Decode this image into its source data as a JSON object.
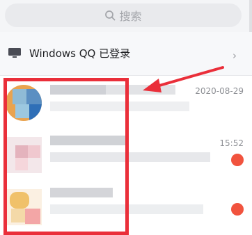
{
  "search": {
    "placeholder": "搜索"
  },
  "device": {
    "label": "Windows QQ 已登录"
  },
  "conversations": [
    {
      "time": "2020-08-29"
    },
    {
      "time": "15:52"
    },
    {
      "time": ""
    }
  ],
  "colors": {
    "annotation_red": "#ea2f3a",
    "badge_red": "#f1533e"
  },
  "icons": [
    "search-icon",
    "monitor-icon",
    "chevron-right-icon"
  ]
}
